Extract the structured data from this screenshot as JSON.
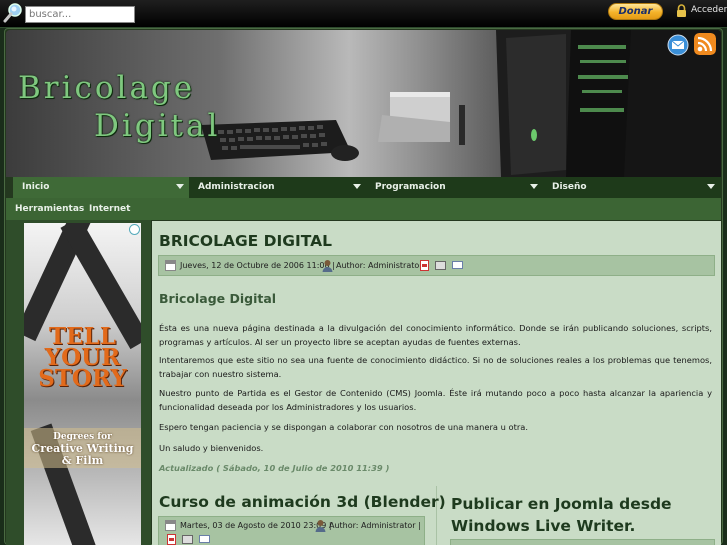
{
  "topbar": {
    "search_placeholder": "buscar...",
    "donate_label": "Donar",
    "login_label": "Acceder"
  },
  "header": {
    "logo_line1": "Bricolage",
    "logo_line2": "Digital",
    "feed_icons": [
      "email-feed-icon",
      "rss-feed-icon"
    ]
  },
  "nav": {
    "primary": [
      {
        "label": "Inicio",
        "active": true
      },
      {
        "label": "Administracion",
        "active": false
      },
      {
        "label": "Programacion",
        "active": false
      },
      {
        "label": "Diseño",
        "active": false
      }
    ],
    "secondary": [
      {
        "label": "Herramientas"
      },
      {
        "label": "Internet"
      }
    ]
  },
  "ad": {
    "title_lines": [
      "TELL",
      "YOUR",
      "STORY"
    ],
    "sub_line1": "Degrees for",
    "sub_line2": "Creative Writing",
    "sub_line3": "& Film"
  },
  "article1": {
    "title": "BRICOLAGE DIGITAL",
    "date": "Jueves, 12 de Octubre de 2006 11:00 |",
    "author": "Author: Administrator |",
    "subtitle": "Bricolage Digital",
    "paragraphs": [
      "Ésta es una nueva página destinada a la divulgación del conocimiento informático. Donde se irán publicando soluciones, scripts, programas y artículos. Al ser un proyecto libre se aceptan ayudas de fuentes externas.",
      "Intentaremos que este sitio no sea una fuente de conocimiento didáctico. Si no de soluciones reales a los problemas que tenemos, trabajar con nuestro sistema.",
      "Nuestro punto de Partida es el Gestor de Contenido (CMS) Joomla. Éste irá mutando poco a poco hasta alcanzar la apariencia y funcionalidad deseada por los Administradores y los usuarios.",
      "Espero tengan paciencia y se dispongan a colaborar con nosotros de una manera u otra.",
      "Un saludo y bienvenidos."
    ],
    "updated": "Actualizado ( Sábado, 10 de Julio de 2010 11:39 )"
  },
  "article2": {
    "title": "Curso de animación 3d (Blender)",
    "date": "Martes, 03 de Agosto de 2010 23:09 |",
    "author": "Author: Administrator |"
  },
  "article3": {
    "title": "Publicar en Joomla desde Windows Live Writer."
  },
  "colors": {
    "page_bg": "#1a2d1a",
    "content_bg": "#c9dcc6",
    "meta_bg": "#a7c3a2",
    "nav_active": "#3f6a37",
    "logo": "#7fc87f",
    "ad_title": "#e26a1b"
  }
}
